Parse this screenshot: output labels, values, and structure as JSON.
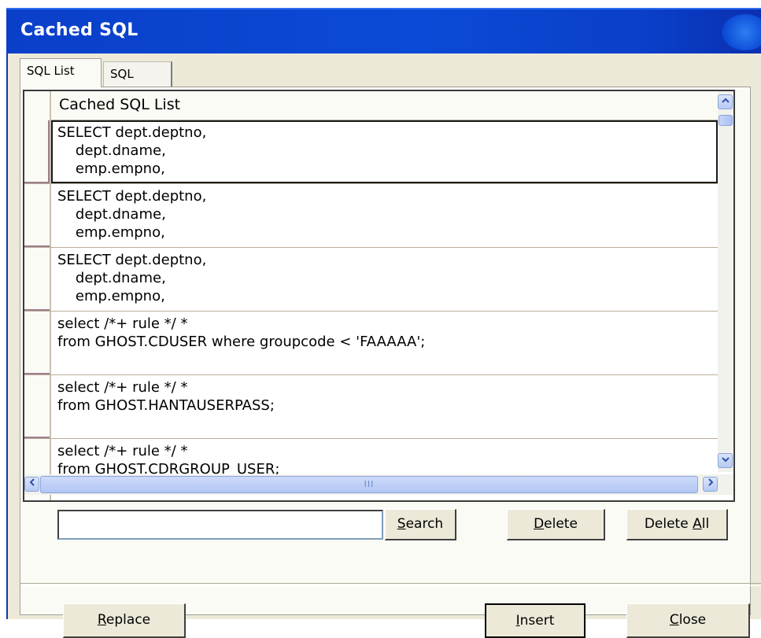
{
  "window": {
    "title": "Cached SQL"
  },
  "tabs": [
    {
      "label": "SQL List",
      "active": true
    },
    {
      "label": "SQL",
      "active": false
    }
  ],
  "grid": {
    "column_header": "Cached SQL List",
    "rows": [
      {
        "text": "SELECT dept.deptno,\n    dept.dname,\n    emp.empno,",
        "selected": true
      },
      {
        "text": "SELECT dept.deptno,\n    dept.dname,\n    emp.empno,",
        "selected": false
      },
      {
        "text": "SELECT dept.deptno,\n    dept.dname,\n    emp.empno,",
        "selected": false
      },
      {
        "text": "select /*+ rule */ *\nfrom GHOST.CDUSER where groupcode < 'FAAAAA';",
        "selected": false
      },
      {
        "text": "select /*+ rule */ *\nfrom GHOST.HANTAUSERPASS;",
        "selected": false
      },
      {
        "text": "select /*+ rule */ *\nfrom GHOST.CDRGROUP_USER;",
        "selected": false
      }
    ],
    "hscroll_grip": "III"
  },
  "search": {
    "value": ""
  },
  "buttons": {
    "search": {
      "label": "Search",
      "mnemonic": "S",
      "rest": "earch"
    },
    "delete": {
      "label": "Delete",
      "mnemonic": "D",
      "rest": "elete"
    },
    "delete_all": {
      "label": "Delete All",
      "prefix": "Delete ",
      "mnemonic": "A",
      "rest": "ll"
    },
    "replace": {
      "label": "Replace",
      "mnemonic": "R",
      "rest": "eplace"
    },
    "insert": {
      "label": "Insert",
      "mnemonic": "I",
      "rest": "nsert"
    },
    "close": {
      "label": "Close",
      "mnemonic": "C",
      "rest": "lose"
    }
  },
  "colors": {
    "titlebar": "#0b4ad6",
    "dialog_bg": "#ece9d8",
    "panel_bg": "#fbfbf6"
  }
}
